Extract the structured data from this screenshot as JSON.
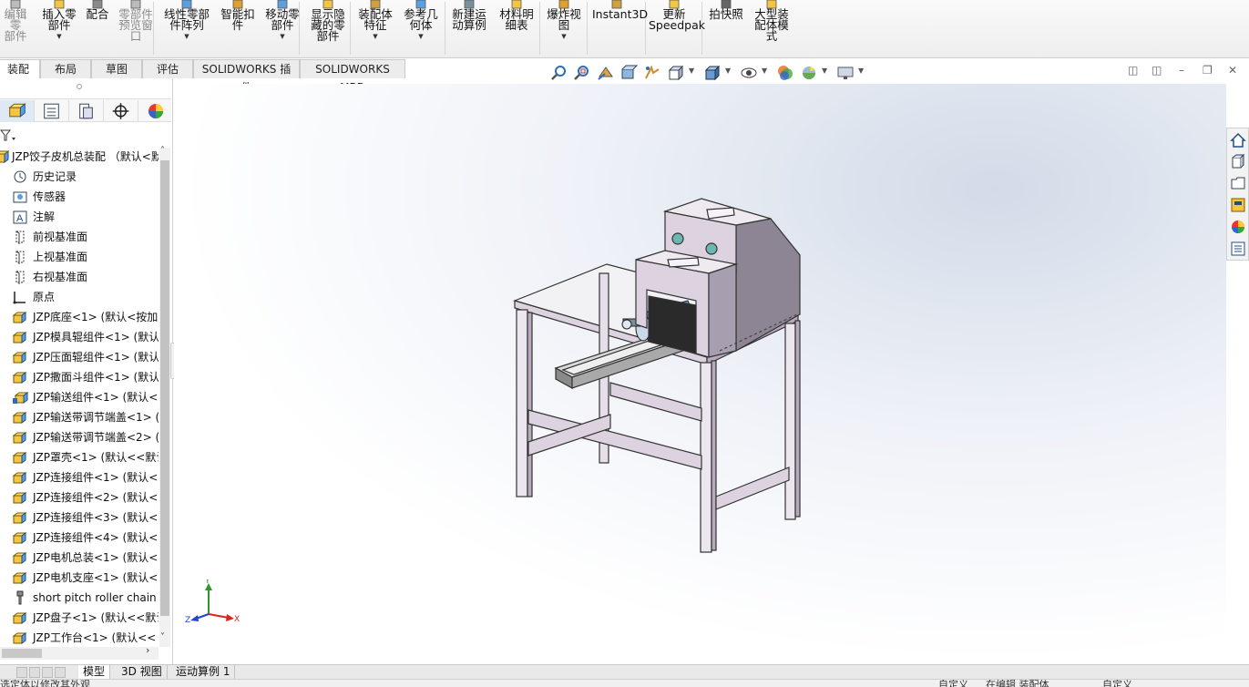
{
  "ribbon": {
    "buttons": [
      {
        "label": "编辑零\n部件",
        "dim": true,
        "caret": false
      },
      {
        "label": "插入零\n部件",
        "dim": false,
        "caret": true
      },
      {
        "label": "配合",
        "dim": false,
        "caret": false
      },
      {
        "label": "零部件\n预览窗\n口",
        "dim": true,
        "caret": false
      },
      {
        "label": "线性零部\n件阵列",
        "dim": false,
        "caret": true
      },
      {
        "label": "智能扣\n件",
        "dim": false,
        "caret": false
      },
      {
        "label": "移动零\n部件",
        "dim": false,
        "caret": true
      },
      {
        "label": "显示隐\n藏的零\n部件",
        "dim": false,
        "caret": false
      },
      {
        "label": "装配体\n特征",
        "dim": false,
        "caret": true
      },
      {
        "label": "参考几\n何体",
        "dim": false,
        "caret": true
      },
      {
        "label": "新建运\n动算例",
        "dim": false,
        "caret": false
      },
      {
        "label": "材料明\n细表",
        "dim": false,
        "caret": false
      },
      {
        "label": "爆炸视\n图",
        "dim": false,
        "caret": true
      },
      {
        "label": "Instant3D",
        "dim": false,
        "caret": false
      },
      {
        "label": "更新\nSpeedpak",
        "dim": false,
        "caret": false
      },
      {
        "label": "拍快照",
        "dim": false,
        "caret": false
      },
      {
        "label": "大型装\n配体模\n式",
        "dim": false,
        "caret": false
      }
    ]
  },
  "tabs": [
    "装配体",
    "布局",
    "草图",
    "评估",
    "SOLIDWORKS 插件",
    "SOLIDWORKS MBD"
  ],
  "tree": {
    "root": "JZP饺子皮机总装配 （默认<默",
    "items": [
      {
        "label": "历史记录",
        "icon": "history-icon"
      },
      {
        "label": "传感器",
        "icon": "sensor-icon"
      },
      {
        "label": "注解",
        "icon": "annotation-icon"
      },
      {
        "label": "前视基准面",
        "icon": "plane-icon"
      },
      {
        "label": "上视基准面",
        "icon": "plane-icon"
      },
      {
        "label": "右视基准面",
        "icon": "plane-icon"
      },
      {
        "label": "原点",
        "icon": "origin-icon"
      },
      {
        "label": "JZP底座<1> (默认<按加工",
        "icon": "subassembly-icon"
      },
      {
        "label": "JZP模具辊组件<1> (默认",
        "icon": "subassembly-icon"
      },
      {
        "label": "JZP压面辊组件<1> (默认",
        "icon": "subassembly-icon"
      },
      {
        "label": "JZP撒面斗组件<1> (默认",
        "icon": "subassembly-icon"
      },
      {
        "label": "JZP输送组件<1> (默认<",
        "icon": "flexible-subassembly-icon"
      },
      {
        "label": "JZP输送带调节端盖<1> (",
        "icon": "subassembly-icon"
      },
      {
        "label": "JZP输送带调节端盖<2> (",
        "icon": "subassembly-icon"
      },
      {
        "label": "JZP罩壳<1> (默认<<默认",
        "icon": "subassembly-icon"
      },
      {
        "label": "JZP连接组件<1> (默认<",
        "icon": "subassembly-icon"
      },
      {
        "label": "JZP连接组件<2> (默认<",
        "icon": "subassembly-icon"
      },
      {
        "label": "JZP连接组件<3> (默认<",
        "icon": "subassembly-icon"
      },
      {
        "label": "JZP连接组件<4> (默认<",
        "icon": "subassembly-icon"
      },
      {
        "label": "JZP电机总装<1> (默认<",
        "icon": "subassembly-icon"
      },
      {
        "label": "JZP电机支座<1> (默认<<",
        "icon": "subassembly-icon"
      },
      {
        "label": "short pitch roller chain w",
        "icon": "toolbox-part-icon"
      },
      {
        "label": "JZP盘子<1> (默认<<默认",
        "icon": "subassembly-icon"
      },
      {
        "label": "JZP工作台<1> (默认<<",
        "icon": "subassembly-icon"
      }
    ]
  },
  "triad": {
    "x": "X",
    "y": "Y",
    "z": "Z"
  },
  "bottom_tabs": [
    "模型",
    "3D 视图",
    "运动算例 1"
  ],
  "status": {
    "left": "选定体以修改其外观",
    "custom1": "自定义",
    "editing": "在编辑 装配体",
    "custom2": "自定义"
  },
  "colors": {
    "accent": "#2a6ebb",
    "frame": "#ddd3e0",
    "hood": "#8d8494"
  }
}
